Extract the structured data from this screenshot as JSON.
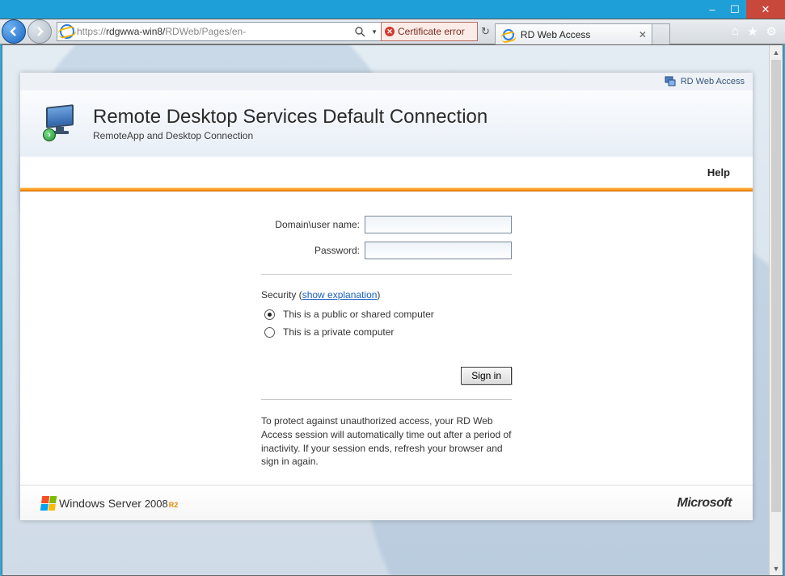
{
  "window": {
    "minimize": "–",
    "maximize": "☐",
    "close": "✕"
  },
  "address": {
    "proto": "https://",
    "host": "rdgwwa-win8/",
    "rest": "RDWeb/Pages/en-"
  },
  "certificate": {
    "label": "Certificate error"
  },
  "tab": {
    "title": "RD Web Access"
  },
  "rd_banner": {
    "label": "RD Web Access"
  },
  "header": {
    "title": "Remote Desktop Services Default Connection",
    "subtitle": "RemoteApp and Desktop Connection"
  },
  "toolbar": {
    "help": "Help"
  },
  "form": {
    "username_label": "Domain\\user name:",
    "password_label": "Password:",
    "security_prefix": "Security (",
    "security_link": "show explanation",
    "security_suffix": ")",
    "opt_public": "This is a public or shared computer",
    "opt_private": "This is a private computer",
    "signin": "Sign in",
    "notice": "To protect against unauthorized access, your RD Web Access session will automatically time out after a period of inactivity. If your session ends, refresh your browser and sign in again."
  },
  "footer": {
    "ws_prefix": "Windows",
    "ws_mid": "Server",
    "ws_year": "2008",
    "ws_r2": "R2",
    "ms": "Microsoft"
  }
}
